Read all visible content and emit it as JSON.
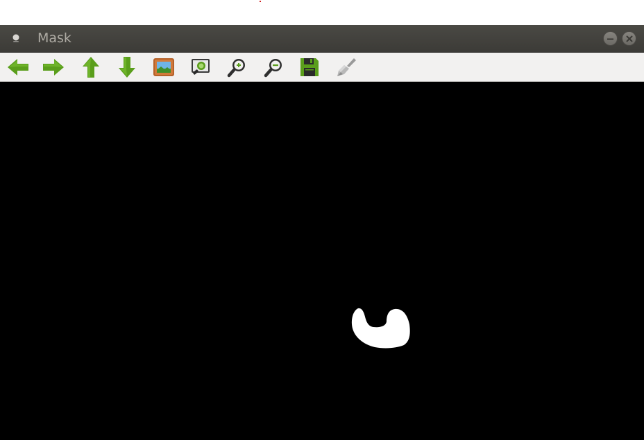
{
  "window": {
    "title": "Mask"
  },
  "toolbar": {
    "icons": [
      "arrow-left-icon",
      "arrow-right-icon",
      "arrow-up-icon",
      "arrow-down-icon",
      "image-icon",
      "zoom-fit-icon",
      "zoom-in-icon",
      "zoom-out-icon",
      "save-icon",
      "brush-icon"
    ]
  },
  "colors": {
    "titlebar": "#3c3b37",
    "title_text": "#aeaba4",
    "toolbar_bg": "#f2f1f0",
    "icon_green": "#5a9e1b",
    "canvas_bg": "#000000",
    "mask_fg": "#ffffff"
  }
}
